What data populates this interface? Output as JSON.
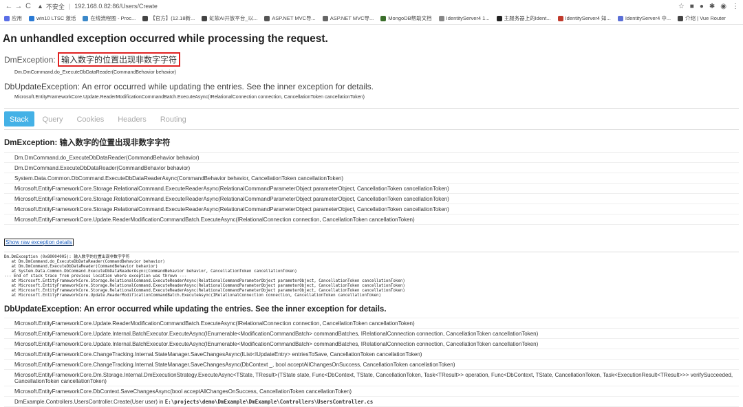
{
  "browser": {
    "security_label": "不安全",
    "url": "192.168.0.82:86/Users/Create",
    "bookmarks": [
      {
        "label": "应用",
        "color": "#5a6ee6"
      },
      {
        "label": "win10 LTSC 激活",
        "color": "#2a7ad4"
      },
      {
        "label": "在线流程图 - Proc...",
        "color": "#3a88c9"
      },
      {
        "label": "【官方】(12.18新...",
        "color": "#444444"
      },
      {
        "label": "虹软AI开放平台_以...",
        "color": "#444444"
      },
      {
        "label": "ASP.NET MVC导...",
        "color": "#555555"
      },
      {
        "label": "ASP.NET MVC导...",
        "color": "#666666"
      },
      {
        "label": "MongoDB帮助文档",
        "color": "#3a6e2a"
      },
      {
        "label": "IdentityServer4 1...",
        "color": "#888888"
      },
      {
        "label": "主服务器上的Ident...",
        "color": "#222222"
      },
      {
        "label": "IdentityServer4 知...",
        "color": "#c0392b"
      },
      {
        "label": "IdentityServer4 中...",
        "color": "#5b6fd6"
      },
      {
        "label": "介绍 | Vue Router",
        "color": "#444444"
      }
    ]
  },
  "page": {
    "title": "An unhandled exception occurred while processing the request.",
    "exception1": {
      "type": "DmException:",
      "message": "输入数字的位置出现非数字字符",
      "location": "Dm.DmCommand.do_ExecuteDbDataReader(CommandBehavior behavior)"
    },
    "exception2": {
      "text": "DbUpdateException: An error occurred while updating the entries. See the inner exception for details.",
      "location": "Microsoft.EntityFrameworkCore.Update.ReaderModificationCommandBatch.ExecuteAsync(IRelationalConnection connection, CancellationToken cancellationToken)"
    },
    "tabs": [
      "Stack",
      "Query",
      "Cookies",
      "Headers",
      "Routing"
    ],
    "stack1": {
      "heading": "DmException: 输入数字的位置出现非数字字符",
      "frames": [
        "Dm.DmCommand.do_ExecuteDbDataReader(CommandBehavior behavior)",
        "Dm.DmCommand.ExecuteDbDataReader(CommandBehavior behavior)",
        "System.Data.Common.DbCommand.ExecuteDbDataReaderAsync(CommandBehavior behavior, CancellationToken cancellationToken)",
        "Microsoft.EntityFrameworkCore.Storage.RelationalCommand.ExecuteReaderAsync(RelationalCommandParameterObject parameterObject, CancellationToken cancellationToken)",
        "Microsoft.EntityFrameworkCore.Storage.RelationalCommand.ExecuteReaderAsync(RelationalCommandParameterObject parameterObject, CancellationToken cancellationToken)",
        "Microsoft.EntityFrameworkCore.Storage.RelationalCommand.ExecuteReaderAsync(RelationalCommandParameterObject parameterObject, CancellationToken cancellationToken)",
        "Microsoft.EntityFrameworkCore.Update.ReaderModificationCommandBatch.ExecuteAsync(IRelationalConnection connection, CancellationToken cancellationToken)"
      ]
    },
    "raw_link": "Show raw exception details",
    "raw_text": "Dm.DmException (0x80004005): 输入数字的位置出现非数字字符\n   at Dm.DmCommand.do_ExecuteDbDataReader(CommandBehavior behavior)\n   at Dm.DmCommand.ExecuteDbDataReader(CommandBehavior behavior)\n   at System.Data.Common.DbCommand.ExecuteDbDataReaderAsync(CommandBehavior behavior, CancellationToken cancellationToken)\n--- End of stack trace from previous location where exception was thrown ---\n   at Microsoft.EntityFrameworkCore.Storage.RelationalCommand.ExecuteReaderAsync(RelationalCommandParameterObject parameterObject, CancellationToken cancellationToken)\n   at Microsoft.EntityFrameworkCore.Storage.RelationalCommand.ExecuteReaderAsync(RelationalCommandParameterObject parameterObject, CancellationToken cancellationToken)\n   at Microsoft.EntityFrameworkCore.Storage.RelationalCommand.ExecuteReaderAsync(RelationalCommandParameterObject parameterObject, CancellationToken cancellationToken)\n   at Microsoft.EntityFrameworkCore.Update.ReaderModificationCommandBatch.ExecuteAsync(IRelationalConnection connection, CancellationToken cancellationToken)",
    "stack2": {
      "heading": "DbUpdateException: An error occurred while updating the entries. See the inner exception for details.",
      "frames": [
        "Microsoft.EntityFrameworkCore.Update.ReaderModificationCommandBatch.ExecuteAsync(IRelationalConnection connection, CancellationToken cancellationToken)",
        "Microsoft.EntityFrameworkCore.Update.Internal.BatchExecutor.ExecuteAsync(IEnumerable<ModificationCommandBatch> commandBatches, IRelationalConnection connection, CancellationToken cancellationToken)",
        "Microsoft.EntityFrameworkCore.Update.Internal.BatchExecutor.ExecuteAsync(IEnumerable<ModificationCommandBatch> commandBatches, IRelationalConnection connection, CancellationToken cancellationToken)",
        "Microsoft.EntityFrameworkCore.ChangeTracking.Internal.StateManager.SaveChangesAsync(IList<IUpdateEntry> entriesToSave, CancellationToken cancellationToken)",
        "Microsoft.EntityFrameworkCore.ChangeTracking.Internal.StateManager.SaveChangesAsync(DbContext _, bool acceptAllChangesOnSuccess, CancellationToken cancellationToken)",
        "Microsoft.EntityFrameworkCore.Dm.Storage.Internal.DmExecutionStrategy.ExecuteAsync<TState, TResult>(TState state, Func<DbContext, TState, CancellationToken, Task<TResult>> operation, Func<DbContext, TState, CancellationToken, Task<ExecutionResult<TResult>>> verifySucceeded, CancellationToken cancellationToken)",
        "Microsoft.EntityFrameworkCore.DbContext.SaveChangesAsync(bool acceptAllChangesOnSuccess, CancellationToken cancellationToken)"
      ],
      "last_frame_prefix": "DmExample.Controllers.UsersController.Create(User user) in ",
      "last_frame_path": "E:\\projects\\demo\\DmExample\\DmExample\\Controllers\\UsersController.cs"
    }
  }
}
